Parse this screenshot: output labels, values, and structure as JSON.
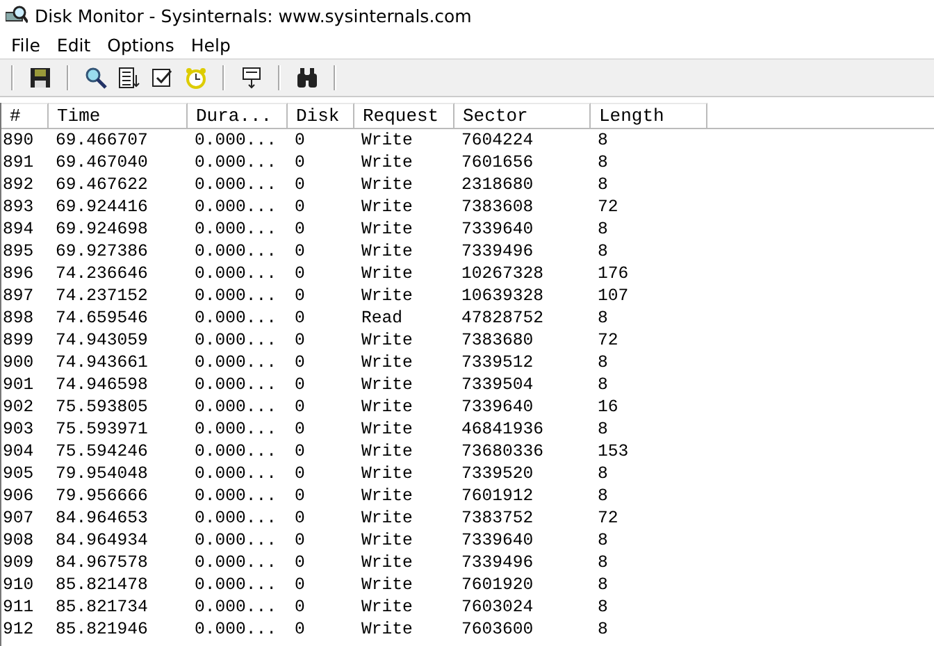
{
  "window": {
    "title": "Disk Monitor - Sysinternals: www.sysinternals.com"
  },
  "menu": [
    "File",
    "Edit",
    "Options",
    "Help"
  ],
  "table": {
    "columns": [
      "#",
      "Time",
      "Dura...",
      "Disk",
      "Request",
      "Sector",
      "Length"
    ],
    "rows": [
      [
        "890",
        "69.466707",
        "0.000...",
        "0",
        "Write",
        "7604224",
        "8"
      ],
      [
        "891",
        "69.467040",
        "0.000...",
        "0",
        "Write",
        "7601656",
        "8"
      ],
      [
        "892",
        "69.467622",
        "0.000...",
        "0",
        "Write",
        "2318680",
        "8"
      ],
      [
        "893",
        "69.924416",
        "0.000...",
        "0",
        "Write",
        "7383608",
        "72"
      ],
      [
        "894",
        "69.924698",
        "0.000...",
        "0",
        "Write",
        "7339640",
        "8"
      ],
      [
        "895",
        "69.927386",
        "0.000...",
        "0",
        "Write",
        "7339496",
        "8"
      ],
      [
        "896",
        "74.236646",
        "0.000...",
        "0",
        "Write",
        "10267328",
        "176"
      ],
      [
        "897",
        "74.237152",
        "0.000...",
        "0",
        "Write",
        "10639328",
        "107"
      ],
      [
        "898",
        "74.659546",
        "0.000...",
        "0",
        "Read",
        "47828752",
        "8"
      ],
      [
        "899",
        "74.943059",
        "0.000...",
        "0",
        "Write",
        "7383680",
        "72"
      ],
      [
        "900",
        "74.943661",
        "0.000...",
        "0",
        "Write",
        "7339512",
        "8"
      ],
      [
        "901",
        "74.946598",
        "0.000...",
        "0",
        "Write",
        "7339504",
        "8"
      ],
      [
        "902",
        "75.593805",
        "0.000...",
        "0",
        "Write",
        "7339640",
        "16"
      ],
      [
        "903",
        "75.593971",
        "0.000...",
        "0",
        "Write",
        "46841936",
        "8"
      ],
      [
        "904",
        "75.594246",
        "0.000...",
        "0",
        "Write",
        "73680336",
        "153"
      ],
      [
        "905",
        "79.954048",
        "0.000...",
        "0",
        "Write",
        "7339520",
        "8"
      ],
      [
        "906",
        "79.956666",
        "0.000...",
        "0",
        "Write",
        "7601912",
        "8"
      ],
      [
        "907",
        "84.964653",
        "0.000...",
        "0",
        "Write",
        "7383752",
        "72"
      ],
      [
        "908",
        "84.964934",
        "0.000...",
        "0",
        "Write",
        "7339640",
        "8"
      ],
      [
        "909",
        "84.967578",
        "0.000...",
        "0",
        "Write",
        "7339496",
        "8"
      ],
      [
        "910",
        "85.821478",
        "0.000...",
        "0",
        "Write",
        "7601920",
        "8"
      ],
      [
        "911",
        "85.821734",
        "0.000...",
        "0",
        "Write",
        "7603024",
        "8"
      ],
      [
        "912",
        "85.821946",
        "0.000...",
        "0",
        "Write",
        "7603600",
        "8"
      ]
    ]
  }
}
